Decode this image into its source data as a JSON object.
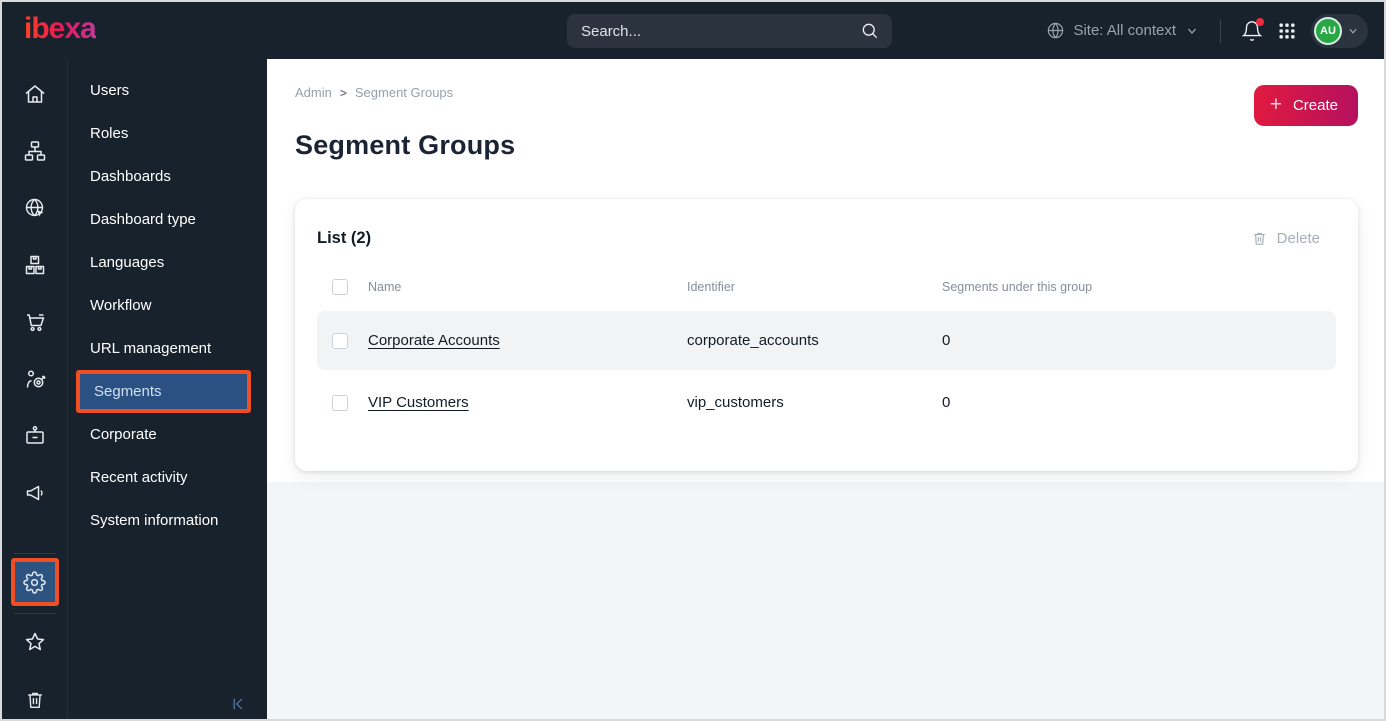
{
  "topbar": {
    "logo_text": "ibexa",
    "search_placeholder": "Search...",
    "site_context_label": "Site: All context",
    "avatar_initials": "AU"
  },
  "icon_rail": {
    "items": [
      "home",
      "content-tree",
      "site",
      "products",
      "commerce-cart",
      "customers-target",
      "customer-portal-badge",
      "campaigns-megaphone"
    ],
    "active_item": "admin-settings-gear",
    "bottom_items": [
      "bookmarks-star",
      "trash"
    ]
  },
  "menu": {
    "items": [
      "Users",
      "Roles",
      "Dashboards",
      "Dashboard type",
      "Languages",
      "Workflow",
      "URL management",
      "Segments",
      "Corporate",
      "Recent activity",
      "System information"
    ],
    "active_item": "Segments"
  },
  "breadcrumb": {
    "parent": "Admin",
    "separator": ">",
    "current": "Segment Groups"
  },
  "page": {
    "title": "Segment Groups",
    "create_button": "Create"
  },
  "list_card": {
    "title": "List (2)",
    "delete_button": "Delete",
    "columns": [
      "Name",
      "Identifier",
      "Segments under this group"
    ],
    "rows": [
      {
        "name": "Corporate Accounts",
        "identifier": "corporate_accounts",
        "segments_count": "0"
      },
      {
        "name": "VIP Customers",
        "identifier": "vip_customers",
        "segments_count": "0"
      }
    ]
  },
  "colors": {
    "topbar_bg": "#18222d",
    "logo_gradient": [
      "#ff4123",
      "#e3175c",
      "#c43a9a"
    ],
    "create_gradient": [
      "#e01a3f",
      "#b5115f"
    ],
    "annotation_highlight": "#f04e23",
    "active_item_bg": "#2a5181",
    "avatar_green": "#27a844",
    "notification_dot": "#ee2b3e",
    "row_stripe": "#f2f3f5"
  }
}
